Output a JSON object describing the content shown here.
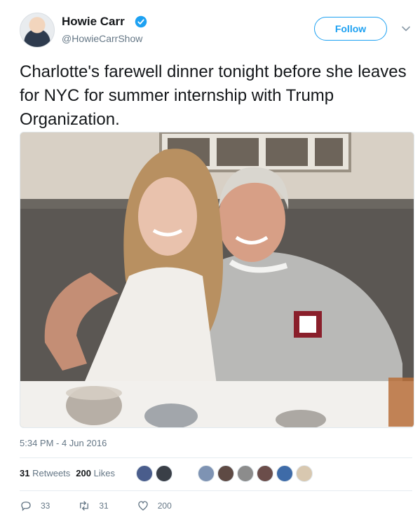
{
  "author": {
    "name": "Howie Carr",
    "handle": "@HowieCarrShow",
    "verified": true,
    "avatar_icon": "avatar-photo"
  },
  "follow_button": {
    "label": "Follow"
  },
  "tweet": {
    "text": "Charlotte's farewell dinner tonight before she leaves for NYC for summer internship with Trump Organization.",
    "media_name": "dinner-photo"
  },
  "timestamp": "5:34 PM - 4 Jun 2016",
  "stats": {
    "retweets_count": "31",
    "retweets_label": "Retweets",
    "likes_count": "200",
    "likes_label": "Likes"
  },
  "actions": {
    "reply_count": "33",
    "retweet_count": "31",
    "like_count": "200"
  },
  "colors": {
    "accent": "#1da1f2",
    "muted": "#657786",
    "text": "#14171a"
  }
}
